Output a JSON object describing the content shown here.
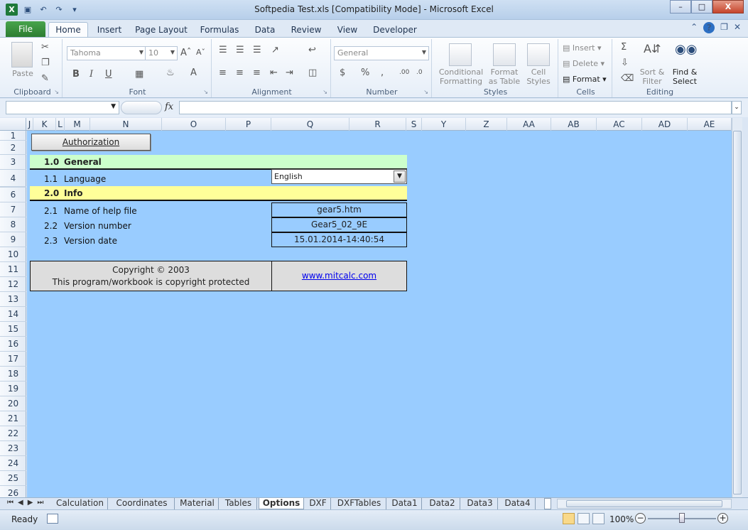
{
  "window": {
    "title": "Softpedia Test.xls  [Compatibility Mode]  -  Microsoft Excel",
    "min_label": "–",
    "max_label": "□",
    "close_label": "X"
  },
  "ribbon": {
    "tabs": [
      "File",
      "Home",
      "Insert",
      "Page Layout",
      "Formulas",
      "Data",
      "Review",
      "View",
      "Developer"
    ],
    "groups": {
      "clipboard": "Clipboard",
      "font": "Font",
      "alignment": "Alignment",
      "number": "Number",
      "styles": "Styles",
      "cells": "Cells",
      "editing": "Editing"
    },
    "paste": "Paste",
    "font_name": "Tahoma",
    "font_size": "10",
    "number_format": "General",
    "conditional": [
      "Conditional",
      "Formatting"
    ],
    "format_table": [
      "Format",
      "as Table"
    ],
    "cell_styles": [
      "Cell",
      "Styles"
    ],
    "insert": "Insert",
    "delete": "Delete",
    "format": "Format",
    "sort": [
      "Sort &",
      "Filter"
    ],
    "find": [
      "Find &",
      "Select"
    ]
  },
  "formula_bar": {
    "fx": "fx",
    "name_box": "",
    "value": ""
  },
  "columns": [
    "J",
    "K",
    "L",
    "M",
    "N",
    "O",
    "P",
    "Q",
    "R",
    "S",
    "Y",
    "Z",
    "AA",
    "AB",
    "AC",
    "AD",
    "AE"
  ],
  "rows": [
    "1",
    "2",
    "3",
    "4",
    "5",
    "6",
    "7",
    "8",
    "9",
    "10",
    "11",
    "12",
    "13",
    "14",
    "15",
    "16",
    "17",
    "18",
    "19",
    "20",
    "21",
    "22",
    "23",
    "24",
    "25",
    "26"
  ],
  "sheet": {
    "auth_button": "Authorization",
    "general": {
      "num": "1.0",
      "label": "General"
    },
    "language": {
      "num": "1.1",
      "label": "Language",
      "value": "English"
    },
    "info": {
      "num": "2.0",
      "label": "Info"
    },
    "help_file": {
      "num": "2.1",
      "label": "Name of help file",
      "value": "gear5.htm"
    },
    "version_number": {
      "num": "2.2",
      "label": "Version number",
      "value": "Gear5_02_9E"
    },
    "version_date": {
      "num": "2.3",
      "label": "Version date",
      "value": "15.01.2014-14:40:54"
    },
    "copyright_line1": "Copyright © 2003",
    "copyright_line2": "This program/workbook is copyright protected",
    "link": "www.mitcalc.com",
    "colors": {
      "sheet_bg": "#99ccff",
      "general_band": "#ccffcc",
      "info_band": "#ffff99",
      "box_bg": "#dddddd"
    }
  },
  "sheet_tabs": {
    "tabs": [
      "Calculation",
      "Coordinates",
      "Material",
      "Tables",
      "Options",
      "DXF",
      "DXFTables",
      "Data1",
      "Data2",
      "Data3",
      "Data4"
    ],
    "active": "Options"
  },
  "status": {
    "ready": "Ready",
    "zoom": "100%"
  }
}
